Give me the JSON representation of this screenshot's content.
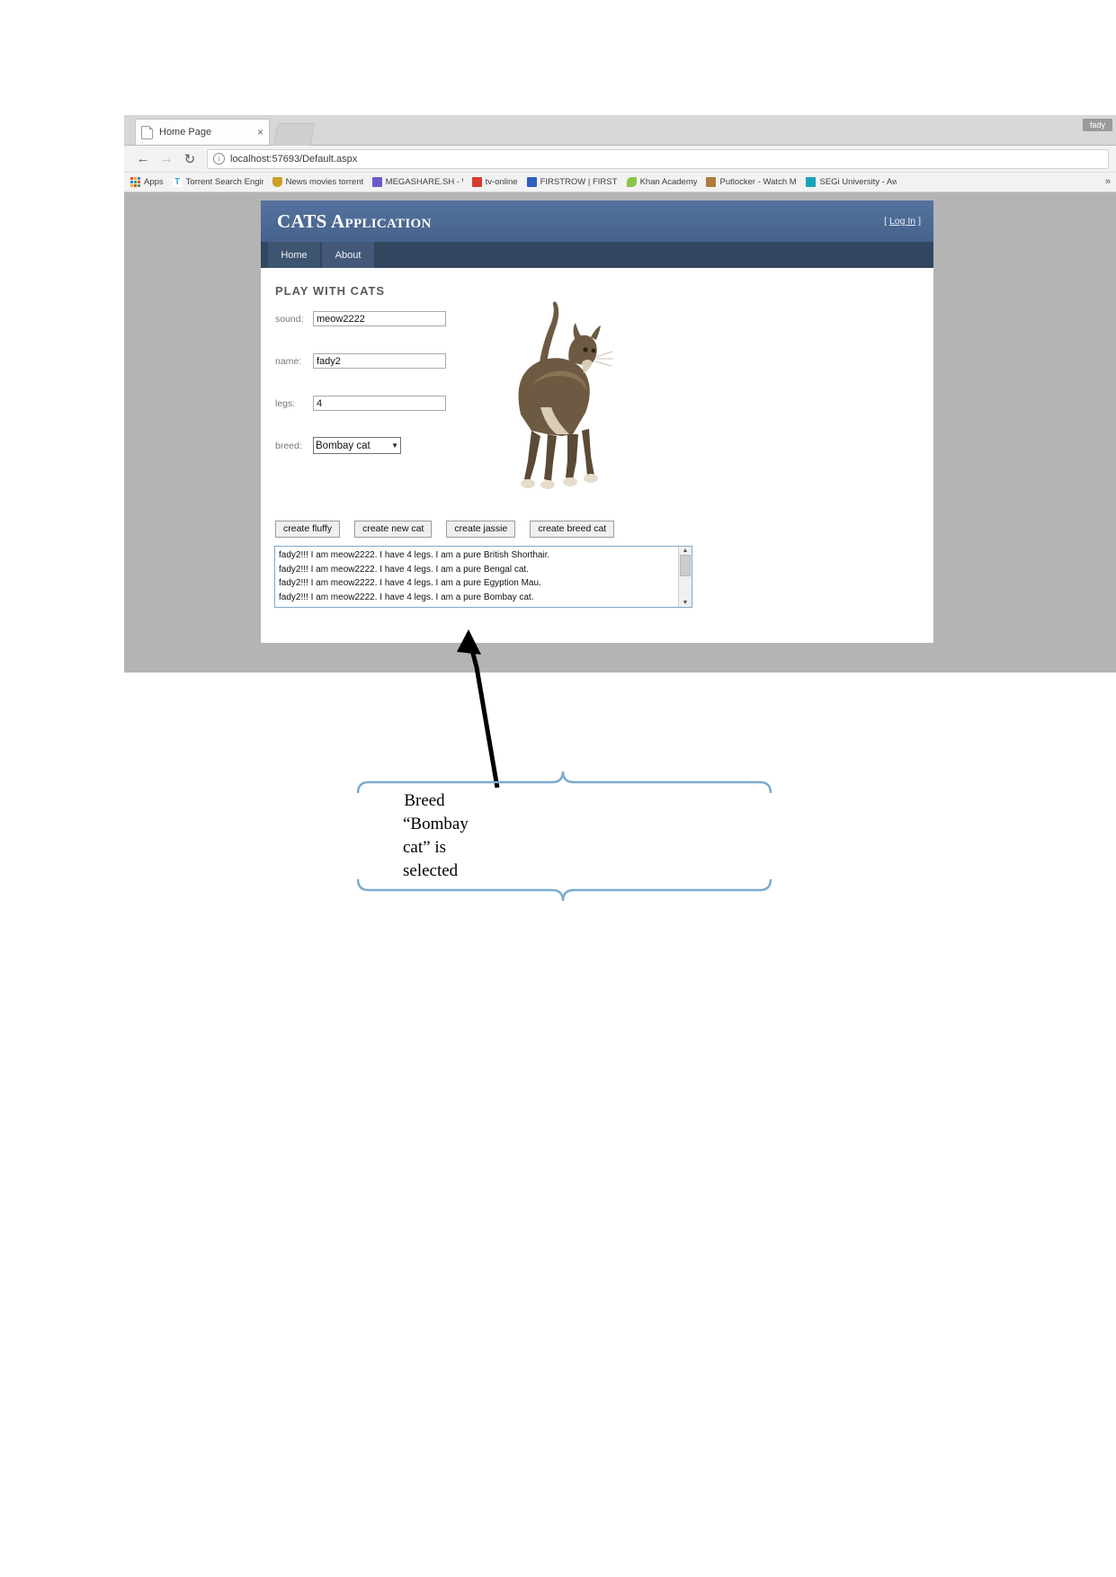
{
  "browser": {
    "tab": {
      "title": "Home Page",
      "close_label": "×",
      "favicon": "page-icon"
    },
    "window_badge": "fady",
    "nav": {
      "back": "←",
      "forward": "→",
      "reload": "↻",
      "info_icon": "i",
      "url": "localhost:57693/Default.aspx"
    },
    "bookmarks": {
      "overflow": "»",
      "items": [
        {
          "label": "Apps",
          "icon": "apps-grid-icon",
          "cls": "bm-apps"
        },
        {
          "label": "Torrent Search Engine",
          "icon": "torrent-icon",
          "cls": "bm-torrent",
          "glyph": "T"
        },
        {
          "label": "News movies torrents",
          "icon": "shield-icon",
          "cls": "bm-news"
        },
        {
          "label": "MEGASHARE.SH - Wa",
          "icon": "film-icon",
          "cls": "bm-mega"
        },
        {
          "label": "tv-online",
          "icon": "tv-icon",
          "cls": "bm-tv"
        },
        {
          "label": "FIRSTROW | FIRSTRO",
          "icon": "sports-icon",
          "cls": "bm-first"
        },
        {
          "label": "Khan Academy",
          "icon": "leaf-icon",
          "cls": "bm-khan"
        },
        {
          "label": "Putlocker - Watch Mo",
          "icon": "reel-icon",
          "cls": "bm-put"
        },
        {
          "label": "SEGi University - Awa",
          "icon": "segi-icon",
          "cls": "bm-segi"
        }
      ]
    }
  },
  "site": {
    "title": "CATS Application",
    "login": {
      "open": "[ ",
      "label": "Log In",
      "close": " ]"
    },
    "nav_tabs": [
      {
        "label": "Home"
      },
      {
        "label": "About"
      }
    ],
    "heading": "PLAY WITH CATS",
    "form": {
      "fields": [
        {
          "label": "sound:",
          "value": "meow2222",
          "name": "sound-input"
        },
        {
          "label": "name:",
          "value": "fady2",
          "name": "name-input"
        },
        {
          "label": "legs:",
          "value": "4",
          "name": "legs-input"
        }
      ],
      "breed": {
        "label": "breed:",
        "selected": "Bombay cat",
        "arrow": "▼",
        "options": [
          "Bombay cat"
        ]
      }
    },
    "buttons": [
      {
        "label": "create fluffy",
        "name": "create-fluffy-button"
      },
      {
        "label": "create new cat",
        "name": "create-new-cat-button"
      },
      {
        "label": "create jassie",
        "name": "create-jassie-button"
      },
      {
        "label": "create breed cat",
        "name": "create-breed-cat-button"
      }
    ],
    "output_lines": [
      "fady2!!! I am meow2222. I have 4 legs. I am a pure British Shorthair.",
      "fady2!!! I am meow2222. I have 4 legs. I am a pure Bengal cat.",
      "fady2!!! I am meow2222. I have 4 legs. I am a pure Egyption Mau.",
      "fady2!!! I am meow2222. I have 4 legs. I am a pure Bombay cat."
    ],
    "scrollbar": {
      "up": "▲",
      "down": "▼"
    }
  },
  "annotation": {
    "text": "Breed “Bombay cat” is selected",
    "brace_color": "#7aaccd",
    "arrow_color": "#000000"
  },
  "colors": {
    "header_blue": "#4A6C9B",
    "nav_dark": "#32465F",
    "page_bg": "#B4B4B4",
    "textarea_border": "#7FA8C9"
  }
}
